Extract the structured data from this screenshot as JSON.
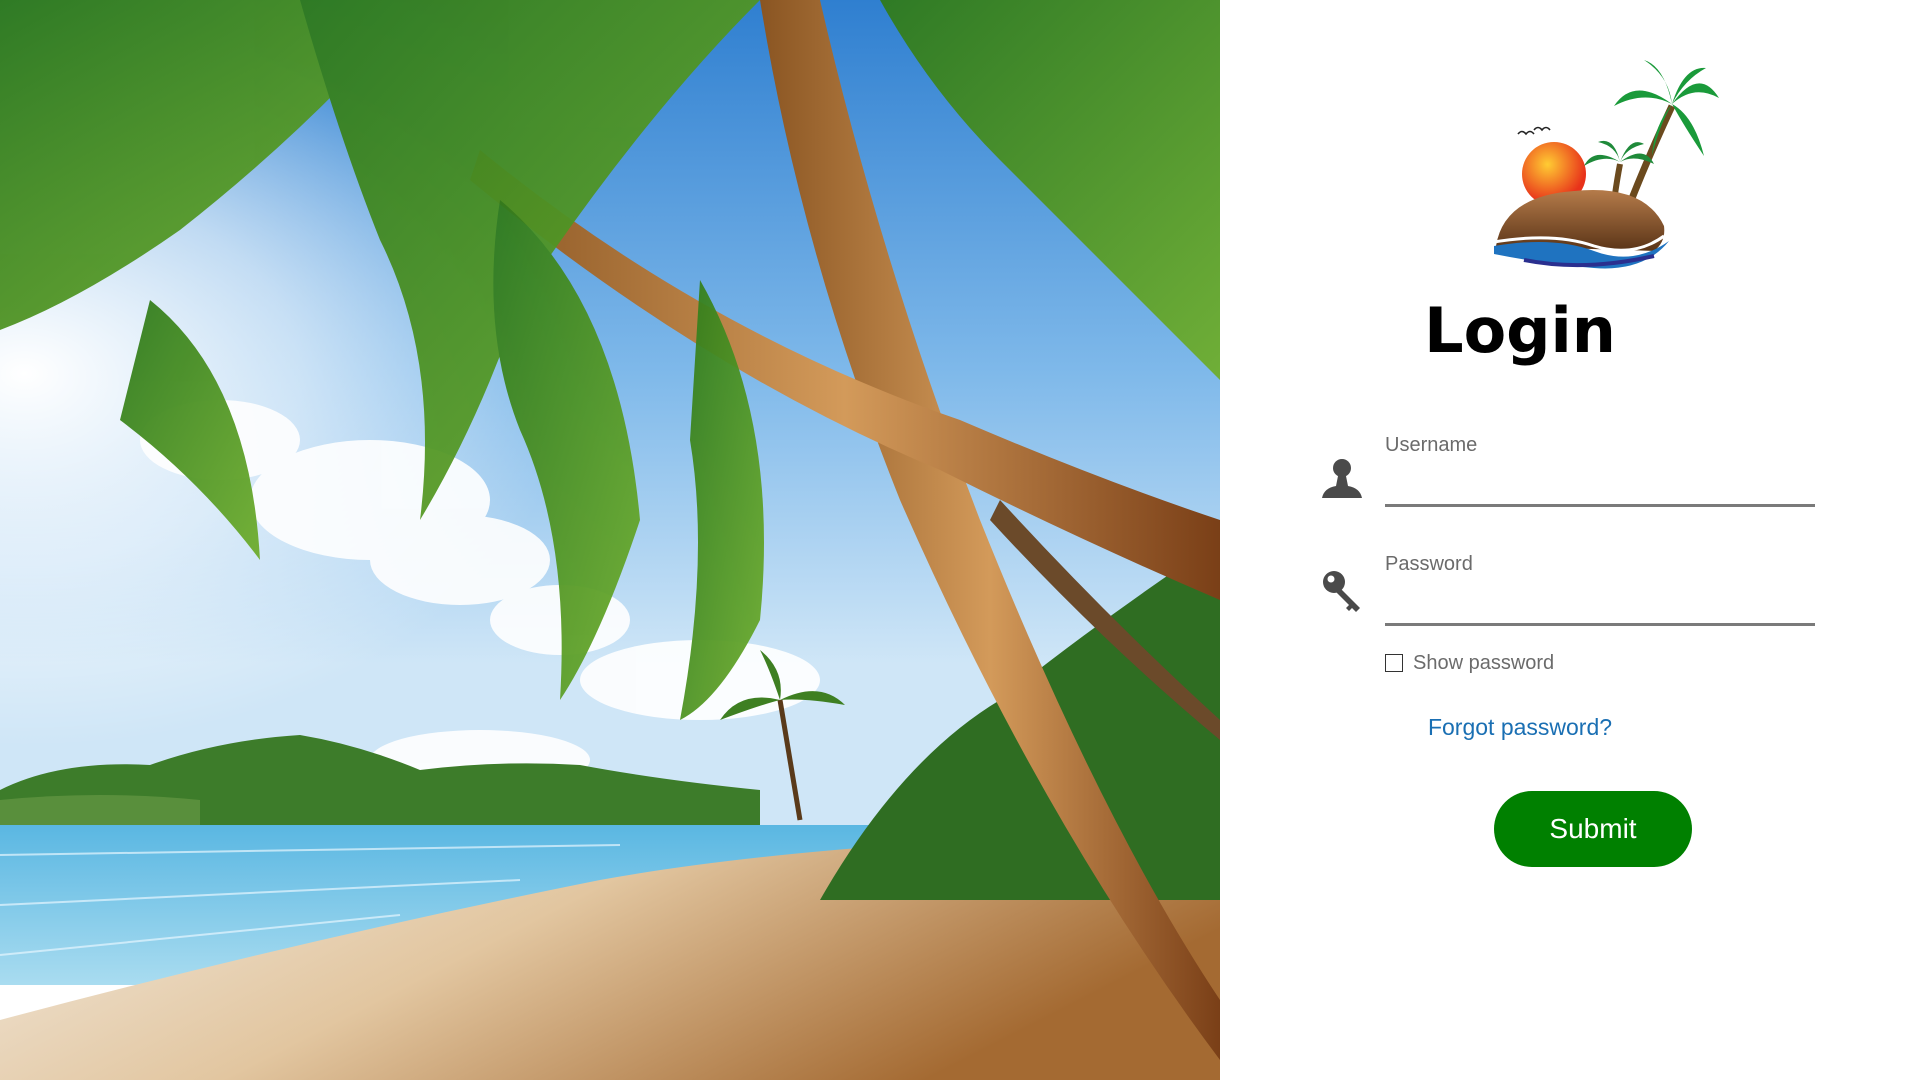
{
  "login": {
    "title": "Login",
    "username_label": "Username",
    "username_value": "",
    "password_label": "Password",
    "password_value": "",
    "show_password_label": "Show password",
    "show_password_checked": false,
    "forgot_link": "Forgot password?",
    "submit_label": "Submit"
  },
  "icons": {
    "username": "person-icon",
    "password": "key-icon",
    "logo": "island-palm-sunset-logo"
  },
  "colors": {
    "submit_bg": "#008000",
    "link": "#1a6fb3",
    "label": "#6b6b6b",
    "underline": "#7a7a7a"
  }
}
